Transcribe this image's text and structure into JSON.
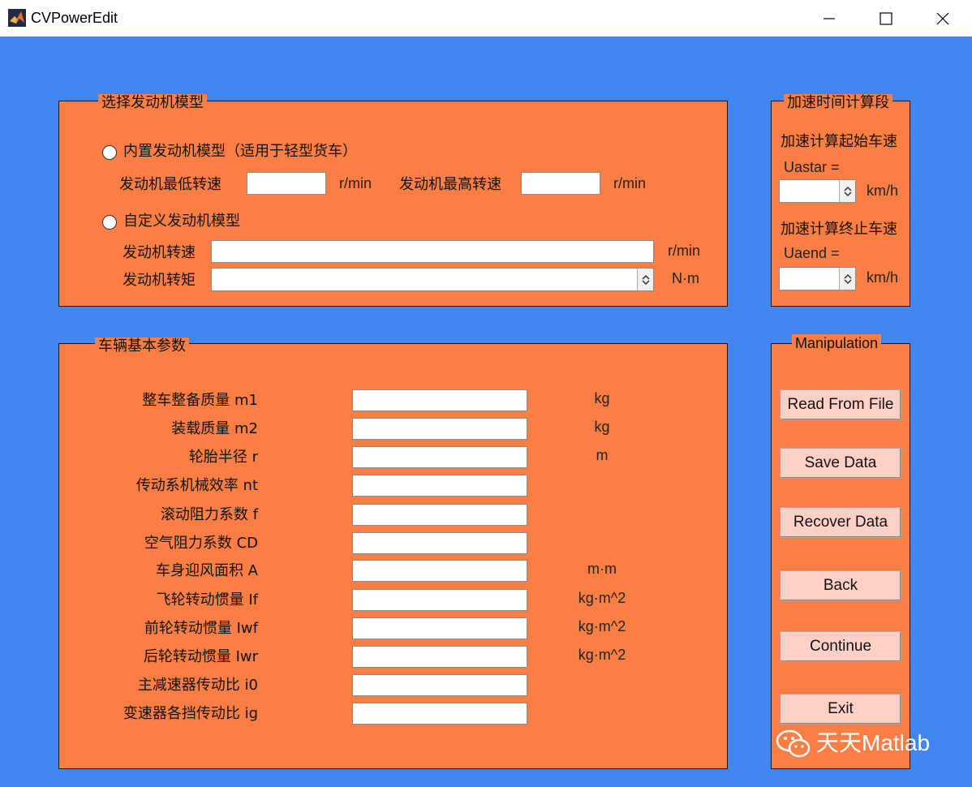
{
  "window": {
    "title": "CVPowerEdit"
  },
  "engine_panel": {
    "title": "选择发动机模型",
    "builtin_label": "内置发动机模型（适用于轻型货车）",
    "min_speed_label": "发动机最低转速",
    "min_speed_unit": "r/min",
    "max_speed_label": "发动机最高转速",
    "max_speed_unit": "r/min",
    "custom_label": "自定义发动机模型",
    "speed_label": "发动机转速",
    "speed_unit": "r/min",
    "torque_label": "发动机转矩",
    "torque_unit": "N·m"
  },
  "accel_panel": {
    "title": "加速时间计算段",
    "start_label": "加速计算起始车速",
    "start_var": "Uastar =",
    "start_unit": "km/h",
    "end_label": "加速计算终止车速",
    "end_var": "Uaend =",
    "end_unit": "km/h"
  },
  "vehicle_panel": {
    "title": "车辆基本参数",
    "params": [
      {
        "label": "整车整备质量 m1",
        "unit": "kg"
      },
      {
        "label": "装载质量 m2",
        "unit": "kg"
      },
      {
        "label": "轮胎半径 r",
        "unit": "m"
      },
      {
        "label": "传动系机械效率 nt",
        "unit": ""
      },
      {
        "label": "滚动阻力系数 f",
        "unit": ""
      },
      {
        "label": "空气阻力系数 CD",
        "unit": ""
      },
      {
        "label": "车身迎风面积 A",
        "unit": "m·m"
      },
      {
        "label": "飞轮转动惯量 If",
        "unit": "kg·m^2"
      },
      {
        "label": "前轮转动惯量 Iwf",
        "unit": "kg·m^2"
      },
      {
        "label": "后轮转动惯量 Iwr",
        "unit": "kg·m^2"
      },
      {
        "label": "主减速器传动比 i0",
        "unit": ""
      },
      {
        "label": "变速器各挡传动比 ig",
        "unit": ""
      }
    ]
  },
  "manip_panel": {
    "title": "Manipulation",
    "read_label": "Read From File",
    "save_label": "Save Data",
    "recover_label": "Recover Data",
    "back_label": "Back",
    "continue_label": "Continue",
    "exit_label": "Exit"
  },
  "watermark": {
    "text": "天天Matlab"
  },
  "colors": {
    "background": "#4284f0",
    "panel": "#fb7f44",
    "button": "#ffd1c6"
  }
}
